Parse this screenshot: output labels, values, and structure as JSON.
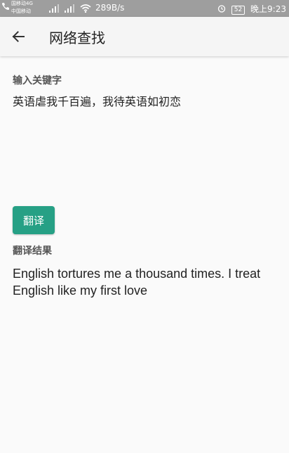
{
  "status_bar": {
    "carrier_line1": "国移动4G",
    "carrier_line2": "中国移动",
    "net_speed": "289B/s",
    "battery": "52",
    "time": "晚上9:23"
  },
  "app_bar": {
    "title": "网络查找"
  },
  "input_section": {
    "label": "输入关键字",
    "value": "英语虐我千百遍，我待英语如初恋"
  },
  "translate_button": {
    "label": "翻译"
  },
  "result_section": {
    "label": "翻译结果",
    "value": "English tortures me a thousand times. I treat English like my first love"
  },
  "colors": {
    "status_bar_bg": "#9e9e9e",
    "app_bar_bg": "#f5f5f5",
    "page_bg": "#fafafa",
    "accent_button": "#26a085"
  }
}
